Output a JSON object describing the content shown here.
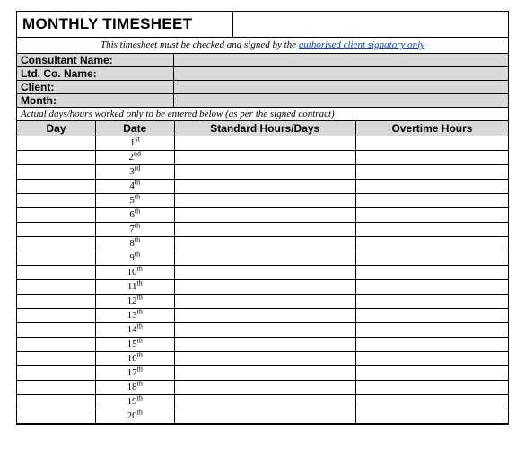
{
  "title": "MONTHLY TIMESHEET",
  "notice_plain": "This timesheet must be checked and signed by the ",
  "notice_link": "authorised client signatory only",
  "info": {
    "consultant_label": "Consultant Name:",
    "ltdco_label": "Ltd. Co. Name:",
    "client_label": "Client:",
    "month_label": "Month:",
    "consultant_value": "",
    "ltdco_value": "",
    "client_value": "",
    "month_value": ""
  },
  "instruction": "Actual days/hours worked only to be entered below (as per the signed contract)",
  "headers": {
    "day": "Day",
    "date": "Date",
    "standard": "Standard Hours/Days",
    "overtime": "Overtime Hours"
  },
  "rows": [
    {
      "day": "",
      "date_num": "1",
      "date_suf": "st",
      "standard": "",
      "overtime": ""
    },
    {
      "day": "",
      "date_num": "2",
      "date_suf": "nd",
      "standard": "",
      "overtime": ""
    },
    {
      "day": "",
      "date_num": "3",
      "date_suf": "rd",
      "standard": "",
      "overtime": ""
    },
    {
      "day": "",
      "date_num": "4",
      "date_suf": "th",
      "standard": "",
      "overtime": ""
    },
    {
      "day": "",
      "date_num": "5",
      "date_suf": "th",
      "standard": "",
      "overtime": ""
    },
    {
      "day": "",
      "date_num": "6",
      "date_suf": "th",
      "standard": "",
      "overtime": ""
    },
    {
      "day": "",
      "date_num": "7",
      "date_suf": "th",
      "standard": "",
      "overtime": ""
    },
    {
      "day": "",
      "date_num": "8",
      "date_suf": "th",
      "standard": "",
      "overtime": ""
    },
    {
      "day": "",
      "date_num": "9",
      "date_suf": "th",
      "standard": "",
      "overtime": ""
    },
    {
      "day": "",
      "date_num": "10",
      "date_suf": "th",
      "standard": "",
      "overtime": ""
    },
    {
      "day": "",
      "date_num": "11",
      "date_suf": "th",
      "standard": "",
      "overtime": ""
    },
    {
      "day": "",
      "date_num": "12",
      "date_suf": "th",
      "standard": "",
      "overtime": ""
    },
    {
      "day": "",
      "date_num": "13",
      "date_suf": "th",
      "standard": "",
      "overtime": ""
    },
    {
      "day": "",
      "date_num": "14",
      "date_suf": "th",
      "standard": "",
      "overtime": ""
    },
    {
      "day": "",
      "date_num": "15",
      "date_suf": "th",
      "standard": "",
      "overtime": ""
    },
    {
      "day": "",
      "date_num": "16",
      "date_suf": "th",
      "standard": "",
      "overtime": ""
    },
    {
      "day": "",
      "date_num": "17",
      "date_suf": "th",
      "standard": "",
      "overtime": ""
    },
    {
      "day": "",
      "date_num": "18",
      "date_suf": "th",
      "standard": "",
      "overtime": ""
    },
    {
      "day": "",
      "date_num": "19",
      "date_suf": "th",
      "standard": "",
      "overtime": ""
    },
    {
      "day": "",
      "date_num": "20",
      "date_suf": "th",
      "standard": "",
      "overtime": ""
    }
  ]
}
